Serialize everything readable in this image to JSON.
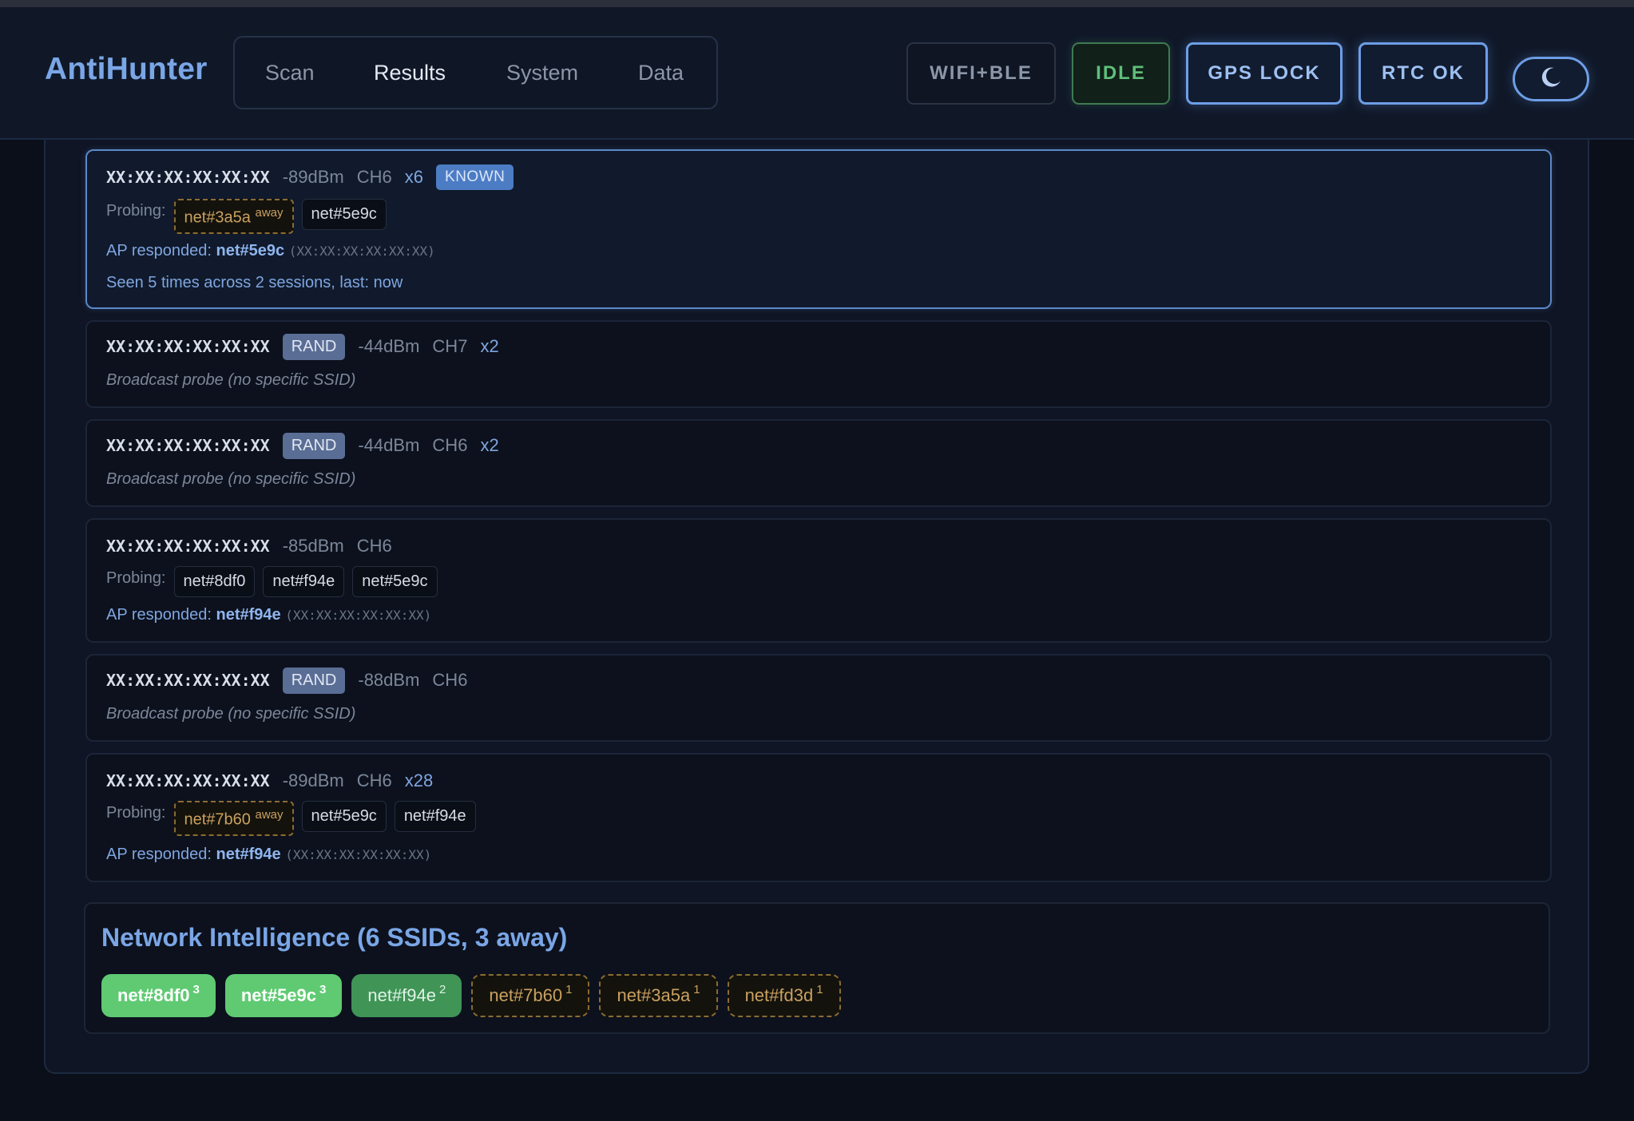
{
  "header": {
    "brand": "AntiHunter",
    "tabs": [
      {
        "label": "Scan"
      },
      {
        "label": "Results"
      },
      {
        "label": "System"
      },
      {
        "label": "Data"
      }
    ],
    "status": {
      "mode": "WIFI+BLE",
      "state": "IDLE",
      "gps": "GPS LOCK",
      "rtc": "RTC OK"
    },
    "theme_icon": "moon-icon"
  },
  "labels": {
    "probing": "Probing:",
    "ap_responded": "AP responded:",
    "broadcast": "Broadcast probe (no specific SSID)",
    "away": "away",
    "rand": "RAND",
    "known": "KNOWN"
  },
  "devices": [
    {
      "mac": "XX:XX:XX:XX:XX:XX",
      "rssi": "-89dBm",
      "channel": "CH6",
      "count": "x6",
      "probes": [
        {
          "ssid": "net#3a5a",
          "away": true
        },
        {
          "ssid": "net#5e9c",
          "away": false
        }
      ],
      "ap_ssid": "net#5e9c",
      "ap_bssid": "(XX:XX:XX:XX:XX:XX)",
      "seen": "Seen 5 times across 2 sessions, last: now"
    },
    {
      "mac": "XX:XX:XX:XX:XX:XX",
      "rssi": "-44dBm",
      "channel": "CH7",
      "count": "x2"
    },
    {
      "mac": "XX:XX:XX:XX:XX:XX",
      "rssi": "-44dBm",
      "channel": "CH6",
      "count": "x2"
    },
    {
      "mac": "XX:XX:XX:XX:XX:XX",
      "rssi": "-85dBm",
      "channel": "CH6",
      "probes": [
        {
          "ssid": "net#8df0"
        },
        {
          "ssid": "net#f94e"
        },
        {
          "ssid": "net#5e9c"
        }
      ],
      "ap_ssid": "net#f94e",
      "ap_bssid": "(XX:XX:XX:XX:XX:XX)"
    },
    {
      "mac": "XX:XX:XX:XX:XX:XX",
      "rssi": "-88dBm",
      "channel": "CH6"
    },
    {
      "mac": "XX:XX:XX:XX:XX:XX",
      "rssi": "-89dBm",
      "channel": "CH6",
      "count": "x28",
      "probes": [
        {
          "ssid": "net#7b60",
          "away": true
        },
        {
          "ssid": "net#5e9c"
        },
        {
          "ssid": "net#f94e"
        }
      ],
      "ap_ssid": "net#f94e",
      "ap_bssid": "(XX:XX:XX:XX:XX:XX)"
    }
  ],
  "intel": {
    "title": "Network Intelligence (6 SSIDs, 3 away)",
    "ssids": [
      {
        "name": "net#8df0",
        "count": "3"
      },
      {
        "name": "net#5e9c",
        "count": "3"
      },
      {
        "name": "net#f94e",
        "count": "2"
      },
      {
        "name": "net#7b60",
        "count": "1"
      },
      {
        "name": "net#3a5a",
        "count": "1"
      },
      {
        "name": "net#fd3d",
        "count": "1"
      }
    ]
  },
  "colors": {
    "accent": "#7aa6e6",
    "known_badge": "#4c7cc4",
    "rand_badge": "#5a6d95",
    "away": "#c9a160",
    "strong_ssid": "#5fca72",
    "idle": "#5fbf7a"
  }
}
